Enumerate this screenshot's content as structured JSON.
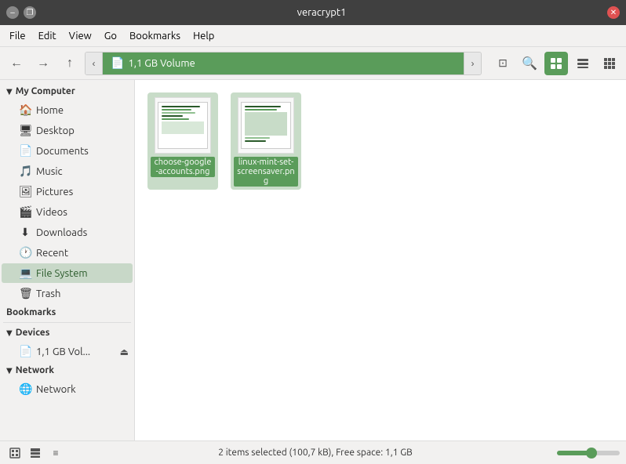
{
  "titlebar": {
    "title": "veracrypt1",
    "min_label": "–",
    "restore_label": "❐",
    "close_label": "✕"
  },
  "menubar": {
    "items": [
      "File",
      "Edit",
      "View",
      "Go",
      "Bookmarks",
      "Help"
    ]
  },
  "toolbar": {
    "back_label": "←",
    "forward_label": "→",
    "up_label": "↑",
    "path_left": "‹",
    "path_right": "›",
    "path_icon": "📄",
    "path_text": "1,1 GB Volume",
    "pin_label": "⊡",
    "search_label": "🔍",
    "view_grid_label": "▦",
    "view_list_label": "☰",
    "view_compact_label": "⊞"
  },
  "sidebar": {
    "my_computer_label": "My Computer",
    "items_computer": [
      {
        "id": "home",
        "label": "Home",
        "icon": "🏠"
      },
      {
        "id": "desktop",
        "label": "Desktop",
        "icon": "🖥"
      },
      {
        "id": "documents",
        "label": "Documents",
        "icon": "📄"
      },
      {
        "id": "music",
        "label": "Music",
        "icon": "🎵"
      },
      {
        "id": "pictures",
        "label": "Pictures",
        "icon": "🖼"
      },
      {
        "id": "videos",
        "label": "Videos",
        "icon": "🎬"
      },
      {
        "id": "downloads",
        "label": "Downloads",
        "icon": "⬇"
      },
      {
        "id": "recent",
        "label": "Recent",
        "icon": "🕐"
      },
      {
        "id": "filesystem",
        "label": "File System",
        "icon": "💻"
      },
      {
        "id": "trash",
        "label": "Trash",
        "icon": "🗑"
      }
    ],
    "bookmarks_label": "Bookmarks",
    "devices_label": "Devices",
    "device_volume": "1,1 GB Vol...",
    "network_label": "Network",
    "network_item_label": "Network"
  },
  "files": [
    {
      "id": "file1",
      "name": "choose-google-accounts.png",
      "selected": true
    },
    {
      "id": "file2",
      "name": "linux-mint-set-screensaver.png",
      "selected": true
    }
  ],
  "statusbar": {
    "text": "2 items selected (100,7 kB), Free space: 1,1 GB",
    "zoom_pct": 55
  }
}
